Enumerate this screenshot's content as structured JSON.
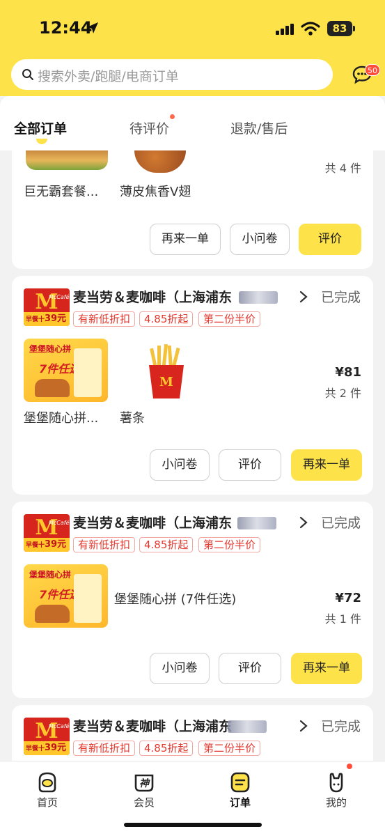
{
  "status_bar": {
    "time": "12:44",
    "battery": "83"
  },
  "search": {
    "placeholder": "搜索外卖/跑腿/电商订单",
    "msg_badge": "50"
  },
  "tabs": [
    {
      "label": "全部订单",
      "active": true
    },
    {
      "label": "待评价",
      "dot": true
    },
    {
      "label": "退款/售后"
    }
  ],
  "orders": [
    {
      "partial": true,
      "items": [
        {
          "name": "巨无霸套餐..."
        },
        {
          "name": "薄皮焦香V翅"
        }
      ],
      "count": "共 4 件",
      "buttons": [
        "再来一单",
        "小问卷",
        "评价"
      ]
    },
    {
      "shop": "麦当劳＆麦咖啡（上海浦东",
      "status": "已完成",
      "logo_text": {
        "brand": "McCafé",
        "strip": "早餐十",
        "strip_num": "39元"
      },
      "promos": [
        "有新低折扣",
        "4.85折起",
        "第二份半价"
      ],
      "items": [
        {
          "name": "堡堡随心拼...",
          "thumb_text": "堡堡随心拼",
          "thumb_sub": "7件任选"
        },
        {
          "name": "薯条"
        }
      ],
      "price": "¥81",
      "count": "共 2 件",
      "buttons": [
        "小问卷",
        "评价",
        "再来一单"
      ]
    },
    {
      "shop": "麦当劳＆麦咖啡（上海浦东",
      "status": "已完成",
      "logo_text": {
        "brand": "McCafé",
        "strip": "早餐十",
        "strip_num": "39元"
      },
      "promos": [
        "有新低折扣",
        "4.85折起",
        "第二份半价"
      ],
      "items": [
        {
          "name": "堡堡随心拼 (7件任选)",
          "thumb_text": "堡堡随心拼",
          "thumb_sub": "7件任选"
        }
      ],
      "price": "¥72",
      "count": "共 1 件",
      "buttons": [
        "小问卷",
        "评价",
        "再来一单"
      ]
    },
    {
      "shop": "麦当劳＆麦咖啡（上海浦东",
      "status": "已完成",
      "logo_text": {
        "brand": "McCafé",
        "strip": "早餐十",
        "strip_num": "39元"
      },
      "promos": [
        "有新低折扣",
        "4.85折起",
        "第二份半价"
      ]
    }
  ],
  "bottom_nav": [
    {
      "label": "首页",
      "icon": "home-icon"
    },
    {
      "label": "会员",
      "icon": "member-icon"
    },
    {
      "label": "订单",
      "icon": "orders-icon",
      "active": true
    },
    {
      "label": "我的",
      "icon": "profile-icon",
      "dot": true
    }
  ],
  "colors": {
    "brand_yellow": "#fde24a",
    "promo_red": "#e2392f",
    "mcd_red": "#d6251c",
    "mcd_gold": "#ffc72c"
  }
}
